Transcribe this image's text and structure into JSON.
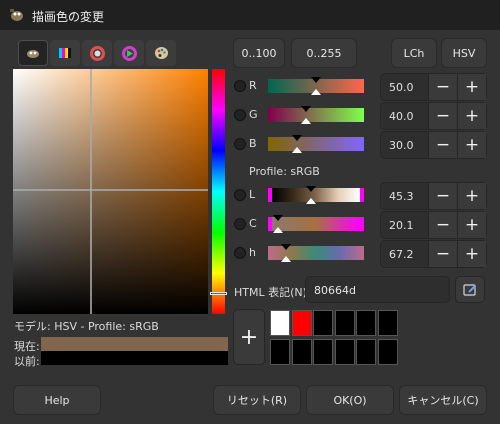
{
  "window": {
    "title": "描画色の変更"
  },
  "selector_tabs": [
    {
      "icon": "gimp-scales-icon"
    },
    {
      "icon": "cmyk-icon"
    },
    {
      "icon": "color-wheel-icon"
    },
    {
      "icon": "triangle-wheel-icon"
    },
    {
      "icon": "palette-icon"
    }
  ],
  "range_buttons": [
    "0..100",
    "0..255"
  ],
  "model_buttons": [
    "LCh",
    "HSV"
  ],
  "rgb_channels": [
    {
      "label": "R",
      "value": "50.0",
      "position": 0.5
    },
    {
      "label": "G",
      "value": "40.0",
      "position": 0.4
    },
    {
      "label": "B",
      "value": "30.0",
      "position": 0.3
    }
  ],
  "profile": "Profile: sRGB",
  "lch_channels": [
    {
      "label": "L",
      "value": "45.3",
      "position": 0.453
    },
    {
      "label": "C",
      "value": "20.1",
      "position": 0.1
    },
    {
      "label": "h",
      "value": "67.2",
      "position": 0.187
    }
  ],
  "spin": {
    "minus": "−",
    "plus": "+"
  },
  "html": {
    "label": "HTML 表記(N):",
    "value": "80664d"
  },
  "model_label": "モデル: HSV - Profile: sRGB",
  "current_label": "現在:",
  "previous_label": "以前:",
  "current_color": "#80664d",
  "previous_color": "#000000",
  "add_button": "+",
  "history_colors": [
    "#ffffff",
    "#ff0000",
    "#000000",
    "#000000",
    "#000000",
    "#000000",
    "#000000",
    "#000000",
    "#000000",
    "#000000",
    "#000000",
    "#000000"
  ],
  "buttons": {
    "help": "Help",
    "reset": "リセット(R)",
    "ok": "OK(O)",
    "cancel": "キャンセル(C)"
  }
}
